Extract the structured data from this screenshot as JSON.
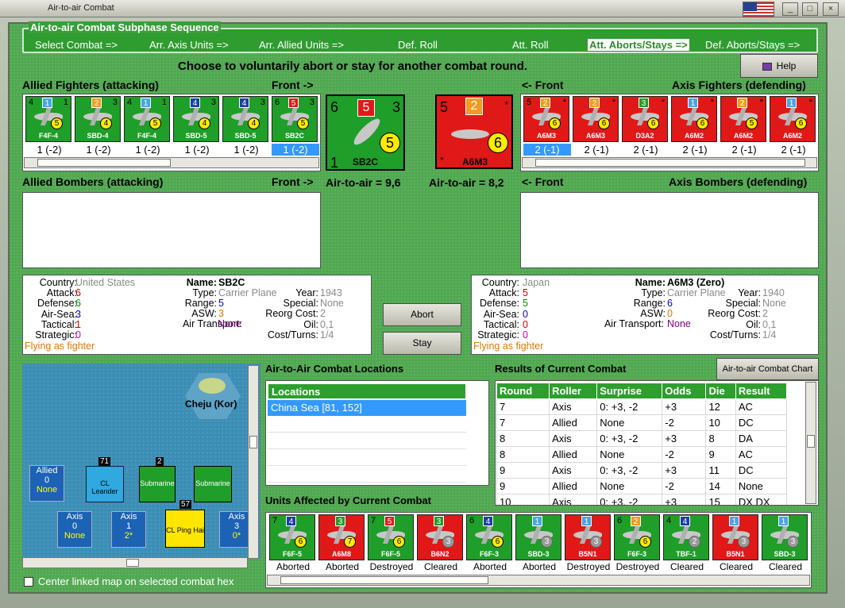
{
  "window": {
    "title": "Air-to-air Combat"
  },
  "sequence": {
    "title": "Air-to-air Combat Subphase Sequence",
    "steps": [
      "Select Combat =>",
      "Arr. Axis Units =>",
      "Arr. Allied Units =>",
      "Def. Roll",
      "Att. Roll",
      "Att. Aborts/Stays =>",
      "Def. Aborts/Stays =>"
    ]
  },
  "prompt": "Choose to voluntarily abort or stay for another combat round.",
  "buttons": {
    "help": "Help",
    "abort": "Abort",
    "stay": "Stay",
    "chart": "Air-to-air Combat Chart"
  },
  "allied_fighters": {
    "label": "Allied Fighters (attacking)",
    "front": "Front ->",
    "units": [
      {
        "atk": "4",
        "def": "1",
        "mv": "1",
        "mvc": "#4aa3e8",
        "circle": "5",
        "name": "F4F-4",
        "value": "1 (-2)",
        "selected": false
      },
      {
        "atk": "",
        "def": "3",
        "mv": "2",
        "mvc": "#f39a20",
        "circle": "4",
        "name": "SBD-4",
        "value": "1 (-2)",
        "selected": false
      },
      {
        "atk": "4",
        "def": "1",
        "mv": "1",
        "mvc": "#4aa3e8",
        "circle": "5",
        "name": "F4F-4",
        "value": "1 (-2)",
        "selected": false
      },
      {
        "atk": "",
        "def": "3",
        "mv": "4",
        "mvc": "#1c3ea8",
        "circle": "4",
        "name": "SBD-5",
        "value": "1 (-2)",
        "selected": false
      },
      {
        "atk": "",
        "def": "3",
        "mv": "4",
        "mvc": "#1c3ea8",
        "circle": "4",
        "name": "SBD-5",
        "value": "1 (-2)",
        "selected": false
      },
      {
        "atk": "6",
        "def": "3",
        "mv": "5",
        "mvc": "#e01818",
        "circle": "5",
        "name": "SB2C",
        "value": "1 (-2)",
        "selected": true
      }
    ]
  },
  "axis_fighters": {
    "label": "Axis Fighters (defending)",
    "front": "<- Front",
    "units": [
      {
        "atk": "5",
        "def": "*",
        "mv": "2",
        "mvc": "#f39a20",
        "circle": "6",
        "name": "A6M3",
        "value": "2 (-1)",
        "selected": true
      },
      {
        "atk": "",
        "def": "*",
        "mv": "2",
        "mvc": "#f39a20",
        "circle": "6",
        "name": "A6M3",
        "value": "2 (-1)",
        "selected": false
      },
      {
        "atk": "",
        "def": "*",
        "mv": "3",
        "mvc": "#1f9e2a",
        "circle": "6",
        "name": "D3A2",
        "value": "2 (-1)",
        "selected": false
      },
      {
        "atk": "",
        "def": "*",
        "mv": "1",
        "mvc": "#4aa3e8",
        "circle": "6",
        "name": "A6M2",
        "value": "2 (-1)",
        "selected": false
      },
      {
        "atk": "",
        "def": "*",
        "mv": "2",
        "mvc": "#f39a20",
        "circle": "5",
        "name": "A6M2",
        "value": "2 (-1)",
        "selected": false
      },
      {
        "atk": "",
        "def": "*",
        "mv": "1",
        "mvc": "#4aa3e8",
        "circle": "6",
        "name": "A6M2",
        "value": "2 (-1)",
        "selected": false
      }
    ]
  },
  "allied_bombers": {
    "label": "Allied Bombers (attacking)",
    "front": "Front ->"
  },
  "axis_bombers": {
    "label": "Axis Bombers (defending)",
    "front": "<- Front"
  },
  "big_allied": {
    "attack": "6",
    "move": "5",
    "defense": "3",
    "circle": "5",
    "bottom": "1",
    "name": "SB2C",
    "air_to_air": "Air-to-air = 9,6"
  },
  "big_axis": {
    "attack": "5",
    "move": "2",
    "circle": "6",
    "name": "A6M3",
    "air_to_air": "Air-to-air = 8,2"
  },
  "stats_labels": {
    "country": "Country:",
    "attack": "Attack:",
    "defense": "Defense:",
    "air_sea": "Air-Sea:",
    "tactical": "Tactical:",
    "strategic": "Strategic:",
    "name": "Name:",
    "type": "Type:",
    "range": "Range:",
    "asw": "ASW:",
    "air_transport": "Air Transport:",
    "year": "Year:",
    "special": "Special:",
    "reorg": "Reorg Cost:",
    "oil": "Oil:",
    "cost": "Cost/Turns:"
  },
  "allied_stats": {
    "country": "United States",
    "attack": "6",
    "defense": "6",
    "air_sea": "3",
    "tactical": "1",
    "strategic": "0",
    "flying": "Flying as fighter",
    "name": "SB2C",
    "type": "Carrier Plane",
    "range": "5",
    "asw": "3",
    "air_transport": "None",
    "year": "1943",
    "special": "None",
    "reorg": "2",
    "oil": "0,1",
    "cost": "1/4"
  },
  "axis_stats": {
    "country": "Japan",
    "attack": "5",
    "defense": "5",
    "air_sea": "0",
    "tactical": "0",
    "strategic": "0",
    "flying": "Flying as fighter",
    "name": "A6M3 (Zero)",
    "type": "Carrier Plane",
    "range": "6",
    "asw": "0",
    "air_transport": "None",
    "year": "1940",
    "special": "None",
    "reorg": "2",
    "oil": "0,1",
    "cost": "1/4"
  },
  "map": {
    "hex_label": "Cheju (Kor)",
    "allied_label": "Allied",
    "allied_count": "0",
    "allied_none": "None",
    "axis_label": "Axis",
    "axis_count1": "0",
    "axis_none": "None",
    "axis_count2": "1",
    "axis_note2": "2*",
    "axis_count3": "3",
    "axis_note3": "0*",
    "units": [
      "CL Leander",
      "Submarine",
      "Submarine",
      "CL Ping Hai"
    ],
    "stack1": "71",
    "stack2": "2",
    "stack3": "57",
    "center_label": "Center linked map on selected combat hex"
  },
  "locations": {
    "title": "Air-to-Air Combat Locations",
    "header": "Locations",
    "items": [
      "China Sea [81, 152]"
    ]
  },
  "results": {
    "title": "Results of Current Combat",
    "columns": [
      "Round",
      "Roller",
      "Surprise",
      "Odds",
      "Die",
      "Result"
    ],
    "rows": [
      [
        "7",
        "Axis",
        "0: +3, -2",
        "+3",
        "12",
        "AC"
      ],
      [
        "7",
        "Allied",
        "None",
        "-2",
        "10",
        "DC"
      ],
      [
        "8",
        "Axis",
        "0: +3, -2",
        "+3",
        "8",
        "DA"
      ],
      [
        "8",
        "Allied",
        "None",
        "-2",
        "9",
        "AC"
      ],
      [
        "9",
        "Axis",
        "0: +3, -2",
        "+3",
        "11",
        "DC"
      ],
      [
        "9",
        "Allied",
        "None",
        "-2",
        "14",
        "None"
      ],
      [
        "10",
        "Axis",
        "0: +3, -2",
        "+3",
        "15",
        "DX DX"
      ]
    ]
  },
  "affected": {
    "title": "Units Affected by Current Combat",
    "units": [
      {
        "atk": "7",
        "mv": "4",
        "mvc": "#1c3ea8",
        "circle": "6",
        "name": "F6F-5",
        "status": "Aborted",
        "side": "g"
      },
      {
        "atk": "",
        "mv": "3",
        "mvc": "#1f9e2a",
        "circle": "7",
        "name": "A6M8",
        "status": "Aborted",
        "side": "r"
      },
      {
        "atk": "7",
        "mv": "5",
        "mvc": "#e01818",
        "circle": "6",
        "name": "F6F-5",
        "status": "Destroyed",
        "side": "g"
      },
      {
        "atk": "",
        "mv": "3",
        "mvc": "#1f9e2a",
        "circle": "3",
        "name": "B6N2",
        "status": "Cleared",
        "side": "r"
      },
      {
        "atk": "6",
        "mv": "4",
        "mvc": "#1c3ea8",
        "circle": "6",
        "name": "F6F-3",
        "status": "Aborted",
        "side": "g"
      },
      {
        "atk": "",
        "mv": "1",
        "mvc": "#4aa3e8",
        "circle": "3",
        "name": "SBD-3",
        "status": "Aborted",
        "side": "g"
      },
      {
        "atk": "",
        "mv": "1",
        "mvc": "#4aa3e8",
        "circle": "3",
        "name": "B5N1",
        "status": "Destroyed",
        "side": "r"
      },
      {
        "atk": "6",
        "mv": "2",
        "mvc": "#f39a20",
        "circle": "6",
        "name": "F6F-3",
        "status": "Destroyed",
        "side": "g"
      },
      {
        "atk": "4",
        "mv": "4",
        "mvc": "#1c3ea8",
        "circle": "2",
        "name": "TBF-1",
        "status": "Cleared",
        "side": "g"
      },
      {
        "atk": "",
        "mv": "1",
        "mvc": "#4aa3e8",
        "circle": "3",
        "name": "B5N1",
        "status": "Cleared",
        "side": "r"
      },
      {
        "atk": "",
        "mv": "1",
        "mvc": "#4aa3e8",
        "circle": "3",
        "name": "SBD-3",
        "status": "Cleared",
        "side": "g"
      }
    ]
  }
}
